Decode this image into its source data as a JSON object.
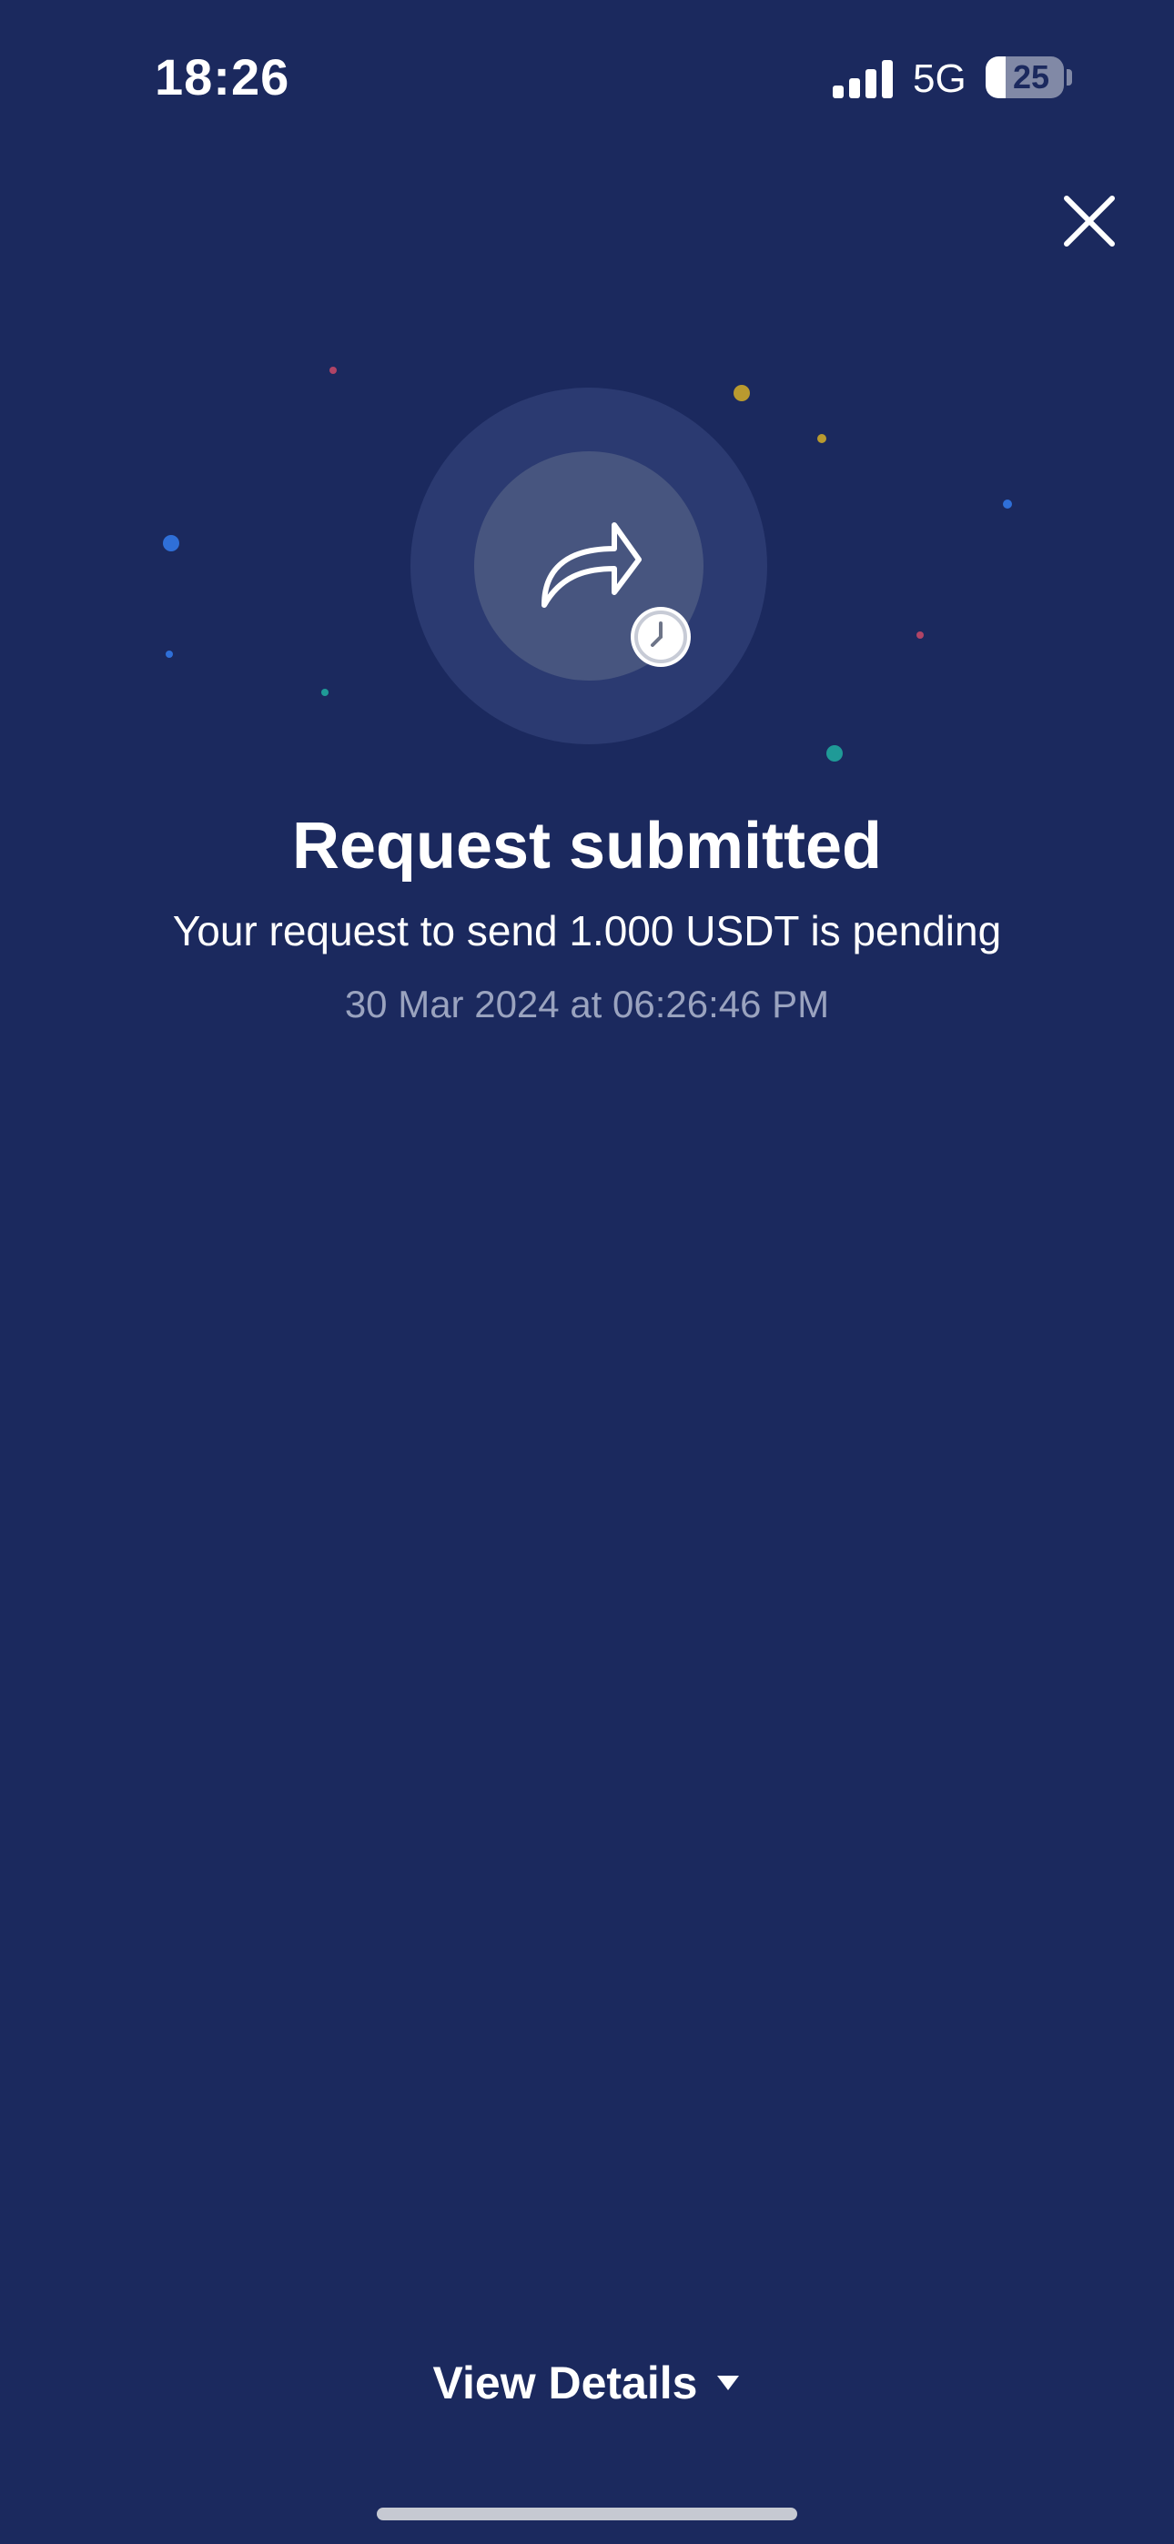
{
  "status_bar": {
    "time": "18:26",
    "network": "5G",
    "battery_level": "25",
    "battery_percent": 25
  },
  "main": {
    "title": "Request submitted",
    "subtitle": "Your request to send 1.000 USDT is pending",
    "timestamp": "30 Mar 2024 at 06:26:46 PM"
  },
  "footer": {
    "view_details_label": "View Details"
  },
  "icons": {
    "close": "close-icon",
    "share": "share-arrow-icon",
    "clock": "clock-icon",
    "caret": "caret-down-icon",
    "signal": "signal-icon"
  },
  "colors": {
    "background": "#1b295e",
    "hero_outer": "#2b3a71",
    "hero_inner": "#47557f",
    "timestamp_text": "#9aa3bf",
    "confetti_gold": "#b99a2f",
    "confetti_blue": "#2f6fd8",
    "confetti_teal": "#1f9a97",
    "confetti_red": "#b04466"
  }
}
